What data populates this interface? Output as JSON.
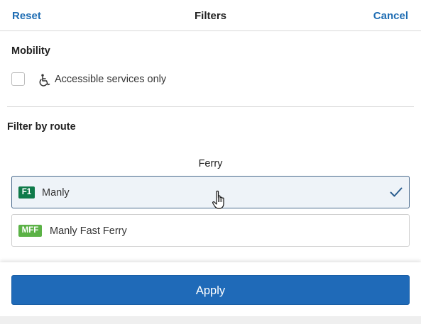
{
  "header": {
    "reset_label": "Reset",
    "title": "Filters",
    "cancel_label": "Cancel"
  },
  "mobility": {
    "title": "Mobility",
    "checkbox_checked": false,
    "accessible_label": "Accessible services only"
  },
  "route_filter": {
    "title": "Filter by route",
    "mode_label": "Ferry",
    "routes": [
      {
        "badge": "F1",
        "badge_color": "#0f7a4a",
        "name": "Manly",
        "selected": true
      },
      {
        "badge": "MFF",
        "badge_color": "#5bb246",
        "name": "Manly Fast Ferry",
        "selected": false
      }
    ]
  },
  "footer": {
    "apply_label": "Apply"
  },
  "colors": {
    "accent": "#1f6db3",
    "apply_button": "#1f6ab8",
    "selected_row_bg": "#eef3f8",
    "selected_row_border": "#4a6a8c"
  }
}
